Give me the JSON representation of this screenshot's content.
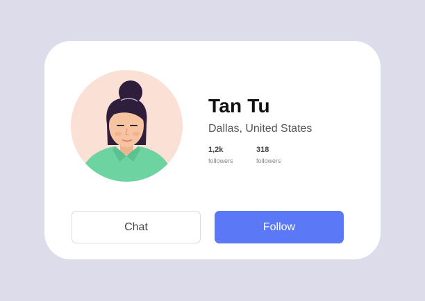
{
  "profile": {
    "name": "Tan Tu",
    "location": "Dallas, United States"
  },
  "stats": [
    {
      "value": "1,2k",
      "label": "followers"
    },
    {
      "value": "318",
      "label": "followers"
    }
  ],
  "actions": {
    "chat_label": "Chat",
    "follow_label": "Follow"
  },
  "colors": {
    "background": "#dcdcea",
    "card": "#ffffff",
    "accent": "#5b78f6",
    "avatar_background": "#fbe0d6",
    "shirt": "#6dd3a0",
    "hair": "#2e1d3b"
  },
  "icons": {
    "avatar": "person-illustration"
  }
}
